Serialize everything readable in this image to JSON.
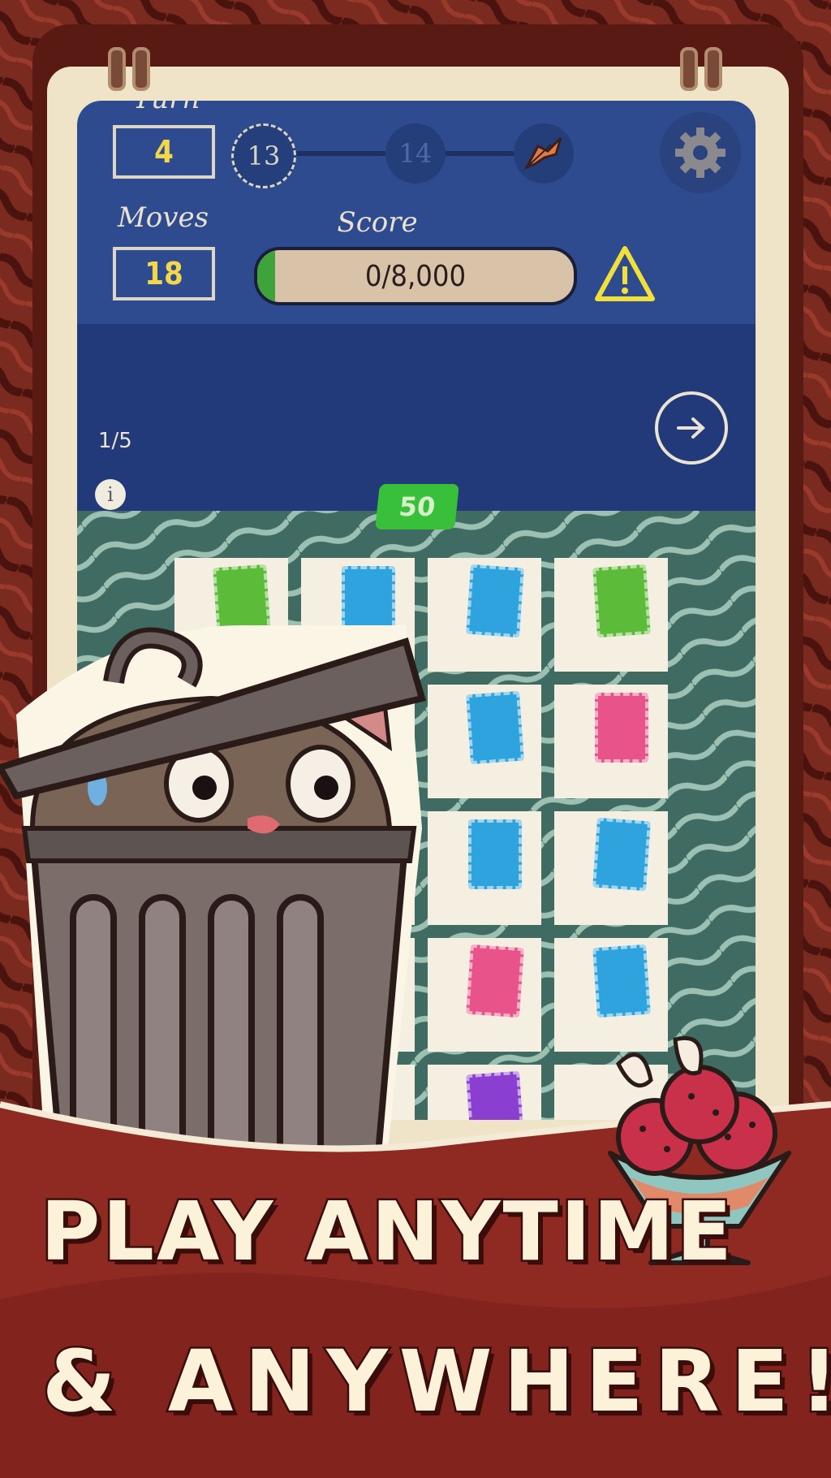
{
  "hud": {
    "turn_label": "Turn",
    "turn_value": "4",
    "moves_label": "Moves",
    "moves_value": "18",
    "score_label": "Score",
    "score_text": "0/8,000",
    "score_progress": 0,
    "levels": [
      "13",
      "14"
    ],
    "page_indicator": "1/5",
    "info_label": "i",
    "points_badge": "50"
  },
  "icons": {
    "settings": "gear-icon",
    "warning": "warning-triangle-icon",
    "next": "arrow-right-circle-icon",
    "reward": "leaf-icon"
  },
  "banner": {
    "line1": "PLAY ANYTIME",
    "line2": "& ANYWHERE!"
  },
  "colors": {
    "frame": "#5a1a14",
    "screen_blue": "#2f4b8f",
    "board_green": "#3f6b62",
    "stamp_green": "#5dbb3a",
    "stamp_blue": "#2fa3dd",
    "stamp_pink": "#e8538a",
    "stamp_purple": "#8a3fd0",
    "accent_yellow": "#f2d74a"
  },
  "board": {
    "tiles": [
      {
        "stamp": "green"
      },
      {
        "stamp": "blue"
      },
      {
        "stamp": "blue"
      },
      {
        "stamp": "green"
      },
      {
        "stamp": ""
      },
      {
        "stamp": ""
      },
      {
        "stamp": "blue"
      },
      {
        "stamp": "pink"
      },
      {
        "stamp": ""
      },
      {
        "stamp": ""
      },
      {
        "stamp": "blue"
      },
      {
        "stamp": "blue"
      },
      {
        "stamp": ""
      },
      {
        "stamp": ""
      },
      {
        "stamp": "pink"
      },
      {
        "stamp": "blue"
      },
      {
        "stamp": ""
      },
      {
        "stamp": ""
      },
      {
        "stamp": "purple"
      },
      {
        "stamp": ""
      }
    ]
  }
}
